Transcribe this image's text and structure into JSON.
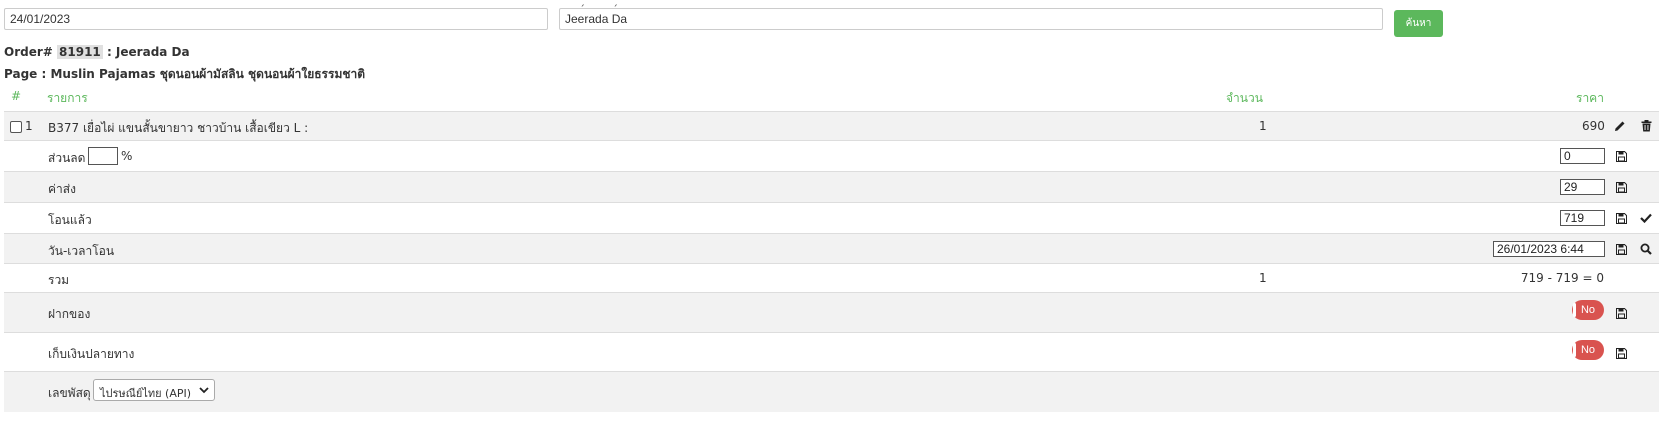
{
  "search": {
    "date_value": "24/01/2023",
    "name_value": "Jeerada Da",
    "button_label": "ค้นหา"
  },
  "order": {
    "prefix": "Order#",
    "number": "81911",
    "customer": ": Jeerada Da",
    "page_line": "Page : Muslin Pajamas ชุดนอนผ้ามัสลิน ชุดนอนผ้าใยธรรมชาติ"
  },
  "table": {
    "headers": {
      "index": "#",
      "item": "รายการ",
      "qty": "จำนวน",
      "price": "ราคา"
    },
    "item_row": {
      "index": "1",
      "name": "B377 เยื่อไผ่ แขนสั้นขายาว ชาวบ้าน เสื้อเขียว L :",
      "qty": "1",
      "price": "690"
    },
    "discount": {
      "label": "ส่วนลด",
      "percent_value": "",
      "percent_sign": "%",
      "value": "0"
    },
    "shipping": {
      "label": "ค่าส่ง",
      "value": "29"
    },
    "transferred": {
      "label": "โอนแล้ว",
      "value": "719"
    },
    "transfer_time": {
      "label": "วัน-เวลาโอน",
      "value": "26/01/2023 6:44"
    },
    "total": {
      "label": "รวม",
      "qty": "1",
      "calc": "719 - 719 = 0"
    },
    "deposit": {
      "label": "ฝากของ",
      "toggle": "No"
    },
    "cod": {
      "label": "เก็บเงินปลายทาง",
      "toggle": "No"
    },
    "tracking": {
      "label": "เลขพัสดุ",
      "carrier_selected": "ไปรษณีย์ไทย (API)"
    }
  },
  "colors": {
    "accent_green": "#5cb85c",
    "toggle_red": "#d9534f"
  },
  "icons": [
    "pencil-icon",
    "trash-icon",
    "save-icon",
    "check-icon",
    "search-icon",
    "chevron-down-icon"
  ]
}
